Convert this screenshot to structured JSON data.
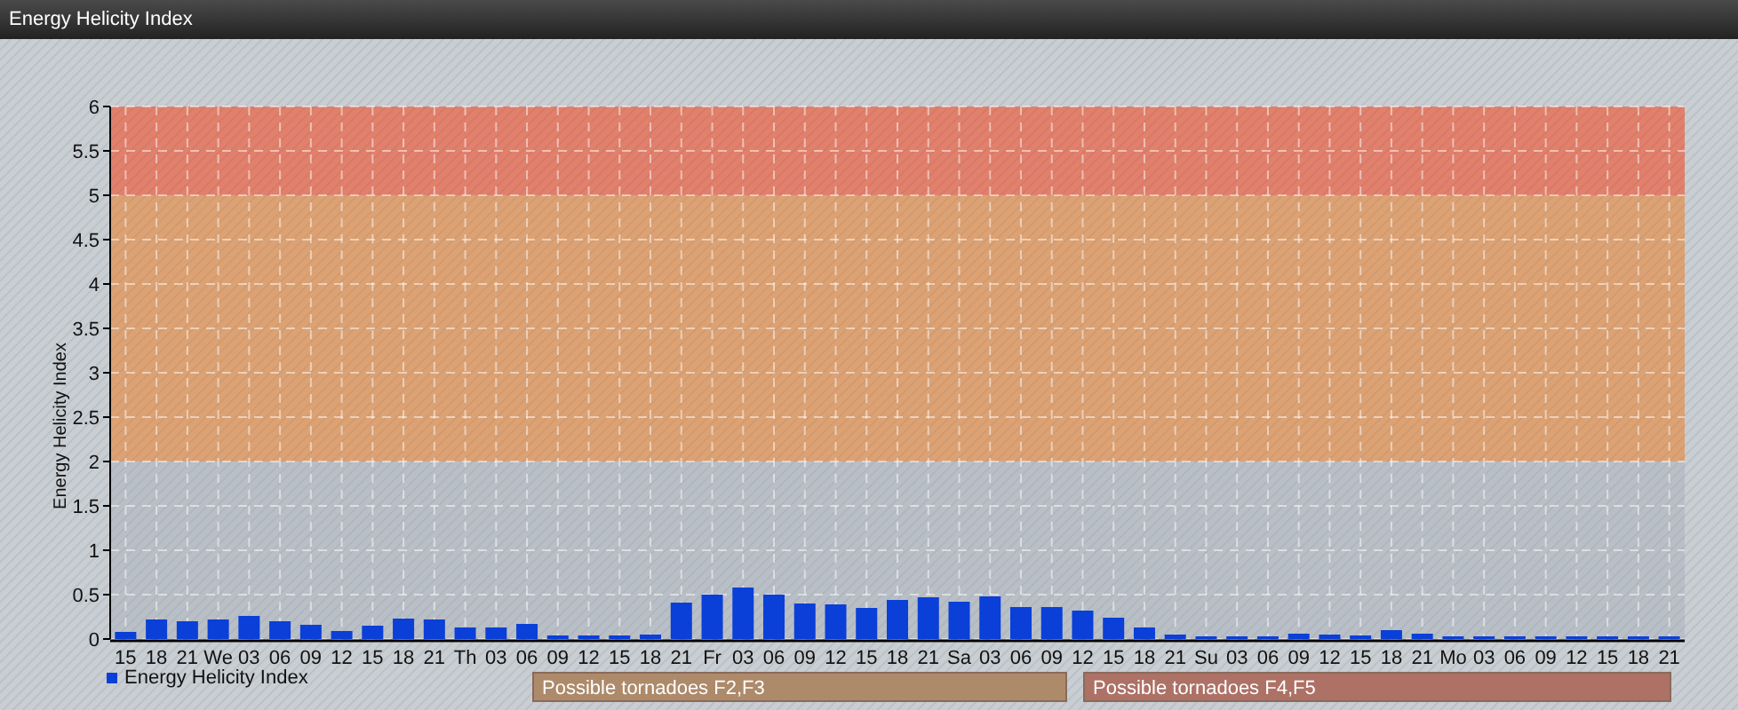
{
  "window": {
    "title": "Energy Helicity Index"
  },
  "chart": {
    "chart_data": {
      "type": "bar",
      "ylabel": "Energy Helicity Index",
      "categories": [
        "15",
        "18",
        "21",
        "We",
        "03",
        "06",
        "09",
        "12",
        "15",
        "18",
        "21",
        "Th",
        "03",
        "06",
        "09",
        "12",
        "15",
        "18",
        "21",
        "Fr",
        "03",
        "06",
        "09",
        "12",
        "15",
        "18",
        "21",
        "Sa",
        "03",
        "06",
        "09",
        "12",
        "15",
        "18",
        "21",
        "Su",
        "03",
        "06",
        "09",
        "12",
        "15",
        "18",
        "21",
        "Mo",
        "03",
        "06",
        "09",
        "12",
        "15",
        "18",
        "21"
      ],
      "series": [
        {
          "name": "Energy Helicity Index",
          "color": "#0a3fd8",
          "values": [
            0.08,
            0.22,
            0.2,
            0.22,
            0.26,
            0.2,
            0.16,
            0.09,
            0.15,
            0.23,
            0.22,
            0.13,
            0.13,
            0.17,
            0.04,
            0.04,
            0.04,
            0.05,
            0.41,
            0.5,
            0.58,
            0.5,
            0.4,
            0.39,
            0.35,
            0.44,
            0.47,
            0.42,
            0.48,
            0.36,
            0.36,
            0.32,
            0.24,
            0.13,
            0.05,
            0.02,
            0.02,
            0.02,
            0.06,
            0.05,
            0.04,
            0.1,
            0.06,
            0.02,
            0.02,
            0.02,
            0.02,
            0.02,
            0.02,
            0.02,
            0.02
          ]
        }
      ],
      "ylim": [
        0,
        6
      ],
      "yticks": [
        0,
        0.5,
        1,
        1.5,
        2,
        2.5,
        3,
        3.5,
        4,
        4.5,
        5,
        5.5,
        6
      ],
      "grid": true,
      "bands": [
        {
          "axis": "y",
          "from": 0,
          "to": 2,
          "color": "#b9bfc7"
        },
        {
          "axis": "y",
          "from": 2,
          "to": 5,
          "color": "#dca274"
        },
        {
          "axis": "y",
          "from": 5,
          "to": 6,
          "color": "#e1806c"
        }
      ]
    },
    "band_labels": [
      {
        "text": "Possible tornadoes F2,F3",
        "color": "#ad8a6a"
      },
      {
        "text": "Possible tornadoes F4,F5",
        "color": "#ad7166"
      }
    ]
  }
}
